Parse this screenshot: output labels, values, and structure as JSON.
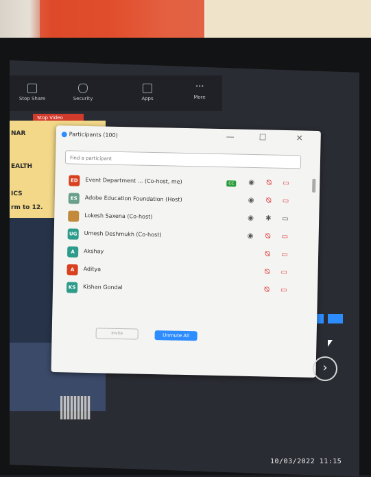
{
  "toolbar": {
    "items": [
      {
        "label": "Stop Share",
        "icon": "stop-share-icon"
      },
      {
        "label": "Security",
        "icon": "shield-icon"
      },
      {
        "label": "Apps",
        "icon": "apps-icon"
      },
      {
        "label": "More",
        "icon": "more-icon"
      }
    ],
    "stop_video": "Stop Video"
  },
  "slide": {
    "lines": [
      "NAR",
      "EALTH",
      "ICS",
      "rm to 12."
    ]
  },
  "participants_window": {
    "title": "Participants (100)",
    "search_placeholder": "Find a participant",
    "members": [
      {
        "initials": "ED",
        "name": "Event Department ... (Co-host, me)",
        "color": "#d8401f",
        "badge": "CC"
      },
      {
        "initials": "ES",
        "name": "Adobe Education Foundation (Host)",
        "color": "#6aa08b"
      },
      {
        "initials": "",
        "name": "Lokesh Saxena (Co-host)",
        "color": "#c28a3a"
      },
      {
        "initials": "UG",
        "name": "Umesh Deshmukh (Co-host)",
        "color": "#2e9c8a"
      },
      {
        "initials": "A",
        "name": "Akshay",
        "color": "#2e9c8a"
      },
      {
        "initials": "A",
        "name": "Aditya",
        "color": "#d8401f"
      },
      {
        "initials": "KS",
        "name": "Kishan Gondal",
        "color": "#2e9c8a"
      }
    ],
    "invite_label": "Invite",
    "unmute_label": "Unmute All"
  },
  "timestamp": "10/03/2022 11:15",
  "colors": {
    "zoom_blue": "#2d8cff",
    "avatar_red": "#d8401f",
    "avatar_teal": "#2e9c8a"
  }
}
